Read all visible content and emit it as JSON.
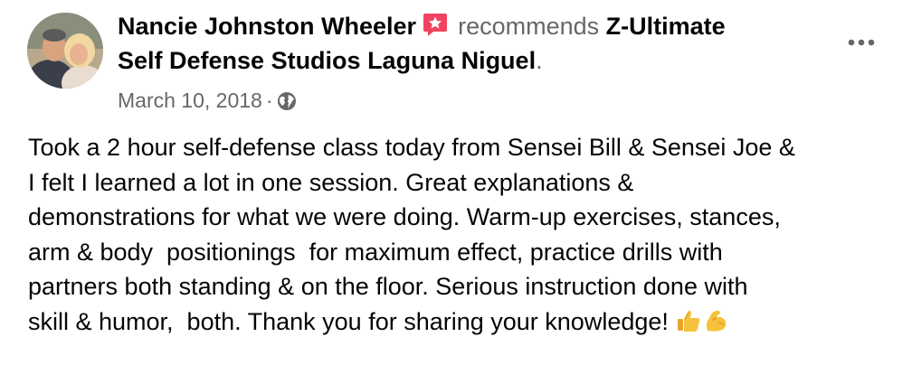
{
  "post": {
    "author_name": "Nancie Johnston Wheeler",
    "verb": "recommends",
    "page_name_line1": "Z-Ultimate",
    "page_name_line2": "Self Defense Studios Laguna Niguel",
    "period": ".",
    "date": "March 10, 2018",
    "separator": "·",
    "audience_icon": "globe-icon",
    "recommend_icon": "recommend-star-icon",
    "more_icon": "more-options-icon",
    "body_lines": [
      "Took a 2 hour self-defense class today from Sensei Bill & Sensei Joe &",
      "I felt I learned a lot in one session. Great explanations &",
      "demonstrations for what we were doing. Warm-up exercises, stances,",
      "arm & body  positionings  for maximum effect, practice drills with",
      "partners both standing & on the floor. Serious instruction done with",
      "skill & humor,  both. Thank you for sharing your knowledge!"
    ],
    "emojis": [
      "thumbs-up-emoji",
      "flexed-biceps-emoji"
    ]
  },
  "colors": {
    "text_primary": "#050505",
    "text_secondary": "#65676b",
    "recommend_red": "#f3425f"
  }
}
